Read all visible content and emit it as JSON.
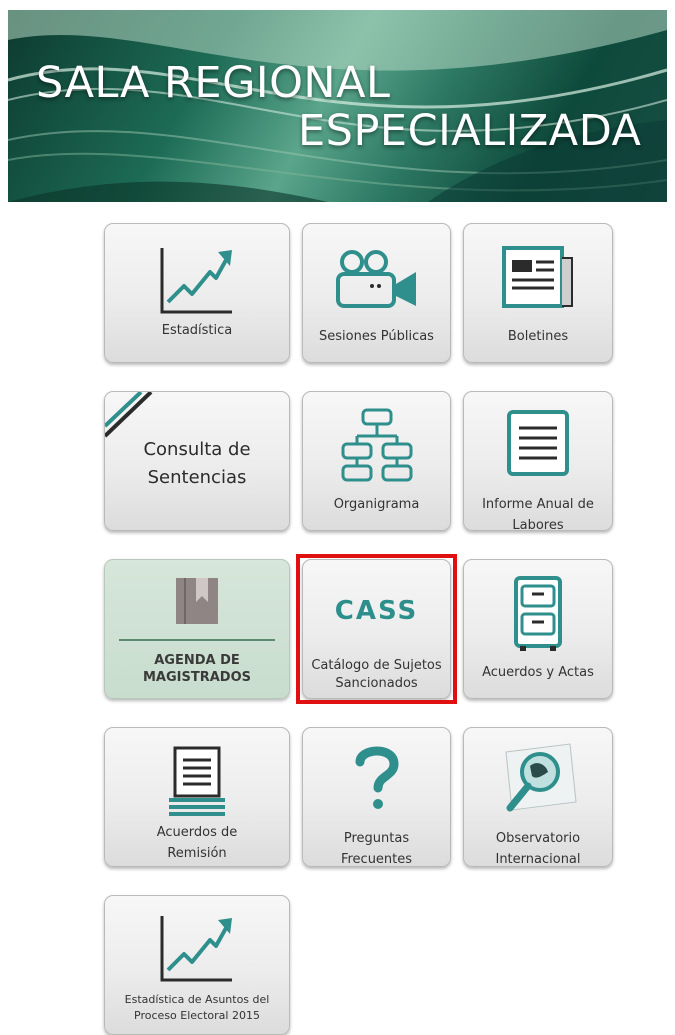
{
  "banner": {
    "line1": "SALA REGIONAL",
    "line2": "ESPECIALIZADA"
  },
  "tiles": {
    "estadistica": "Estadística",
    "sesiones": "Sesiones Públicas",
    "boletines": "Boletines",
    "consulta_line1": "Consulta de",
    "consulta_line2": "Sentencias",
    "organigrama": "Organigrama",
    "informe_line1": "Informe Anual de",
    "informe_line2": "Labores",
    "agenda_line1": "AGENDA DE",
    "agenda_line2": "MAGISTRADOS",
    "cass_logo": "CASS",
    "cass_line1": "Catálogo de Sujetos",
    "cass_line2": "Sancionados",
    "acuerdos_actas": "Acuerdos y Actas",
    "remision_line1": "Acuerdos de",
    "remision_line2": "Remisión",
    "preguntas": "Preguntas Frecuentes",
    "observatorio_line1": "Observatorio",
    "observatorio_line2": "Internacional",
    "est2015_line1": "Estadística de Asuntos del",
    "est2015_line2": "Proceso Electoral 2015"
  },
  "colors": {
    "icon_teal": "#2f8f8c",
    "icon_dark": "#2b2b2b",
    "highlight": "#e01010",
    "agenda_bg": "#d6e6da"
  },
  "icons": [
    "line-chart-icon",
    "video-camera-icon",
    "newspaper-icon",
    "org-chart-icon",
    "document-lines-icon",
    "bookmark-book-icon",
    "filing-cabinet-icon",
    "document-stack-icon",
    "question-mark-icon",
    "globe-magnifier-icon"
  ]
}
